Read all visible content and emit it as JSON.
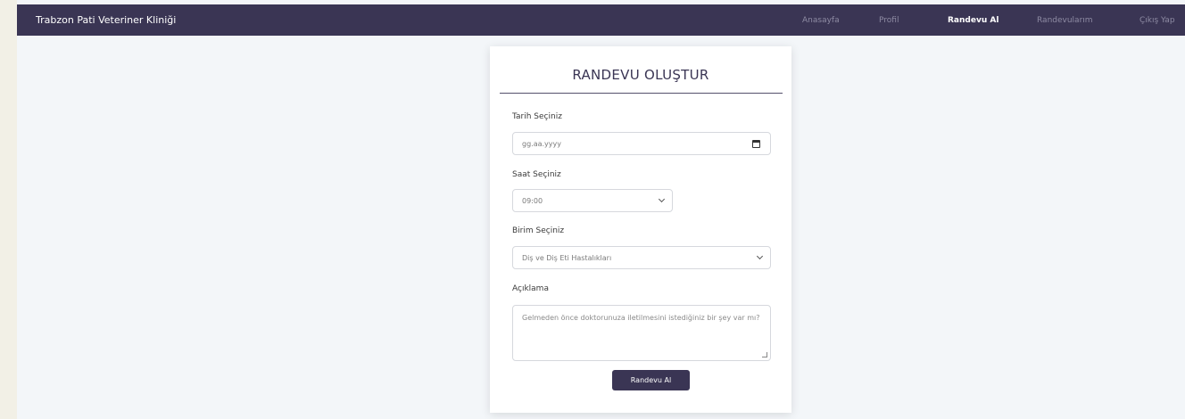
{
  "navbar": {
    "brand": "Trabzon Pati Veteriner Kliniği",
    "links": [
      {
        "label": "Anasayfa",
        "active": false
      },
      {
        "label": "Profil",
        "active": false
      },
      {
        "label": "Randevu Al",
        "active": true
      },
      {
        "label": "Randevularım",
        "active": false
      },
      {
        "label": "Çıkış Yap",
        "active": false
      }
    ]
  },
  "form": {
    "title": "RANDEVU OLUŞTUR",
    "date": {
      "label": "Tarih Seçiniz",
      "value": "gg.aa.yyyy",
      "icon": "calendar-icon"
    },
    "time": {
      "label": "Saat Seçiniz",
      "value": "09:00"
    },
    "unit": {
      "label": "Birim Seçiniz",
      "value": "Diş ve Diş Eti Hastalıkları"
    },
    "description": {
      "label": "Açıklama",
      "placeholder": "Gelmeden önce doktorunuza iletilmesini istediğiniz bir şey var mı?"
    },
    "submit_label": "Randevu Al"
  },
  "colors": {
    "navbar_bg": "#3a3554",
    "accent": "#3a3554",
    "page_bg": "#f3f6f9"
  }
}
